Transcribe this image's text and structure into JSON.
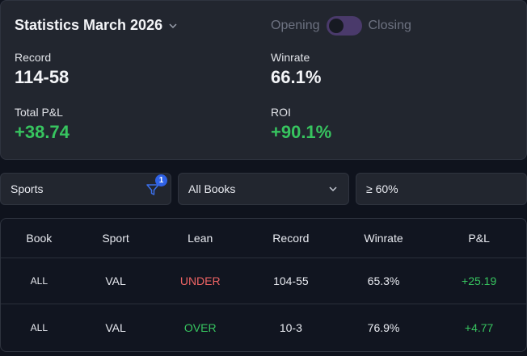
{
  "stats": {
    "title": "Statistics March 2026",
    "toggle_left": "Opening",
    "toggle_right": "Closing",
    "record_label": "Record",
    "record_value": "114-58",
    "winrate_label": "Winrate",
    "winrate_value": "66.1%",
    "pnl_label": "Total P&L",
    "pnl_value": "+38.74",
    "roi_label": "ROI",
    "roi_value": "+90.1%"
  },
  "filters": {
    "sport": "Sports",
    "sport_badge": "1",
    "books": "All Books",
    "threshold": "≥ 60%"
  },
  "table": {
    "headers": [
      "Book",
      "Sport",
      "Lean",
      "Record",
      "Winrate",
      "P&L"
    ],
    "rows": [
      {
        "book": "ALL",
        "sport": "VAL",
        "lean": "UNDER",
        "record": "104-55",
        "winrate": "65.3%",
        "pnl": "+25.19"
      },
      {
        "book": "ALL",
        "sport": "VAL",
        "lean": "OVER",
        "record": "10-3",
        "winrate": "76.9%",
        "pnl": "+4.77"
      }
    ]
  },
  "colors": {
    "positive": "#37c45f",
    "negative": "#ef6464",
    "accent": "#2f62e6"
  }
}
